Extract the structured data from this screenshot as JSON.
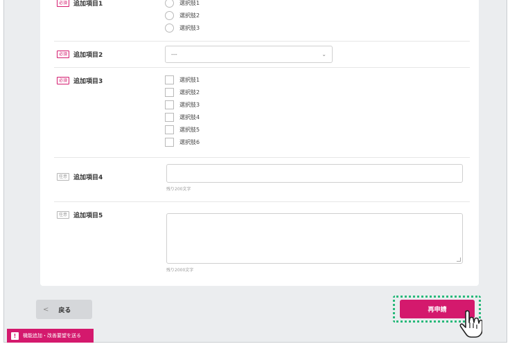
{
  "form": {
    "field1": {
      "title": "追加項目1",
      "badge": "必須",
      "options": [
        "選択肢1",
        "選択肢2",
        "選択肢3"
      ]
    },
    "field2": {
      "title": "追加項目2",
      "badge": "必須",
      "select_value": "---"
    },
    "field3": {
      "title": "追加項目3",
      "badge": "必須",
      "options": [
        "選択肢1",
        "選択肢2",
        "選択肢3",
        "選択肢4",
        "選択肢5",
        "選択肢6"
      ]
    },
    "field4": {
      "title": "追加項目4",
      "badge": "任意",
      "value": "",
      "counter": "残り200文字"
    },
    "field5": {
      "title": "追加項目5",
      "badge": "任意",
      "value": "",
      "counter": "残り2000文字"
    }
  },
  "actions": {
    "back_label": "戻る",
    "back_chevron": "<",
    "reapply_label": "再申請"
  },
  "feedback": {
    "label": "機能追加・改善要望を送る",
    "icon": "!"
  },
  "colors": {
    "accent": "#d4196d",
    "highlight": "#27b97a",
    "background": "#ebedef"
  }
}
